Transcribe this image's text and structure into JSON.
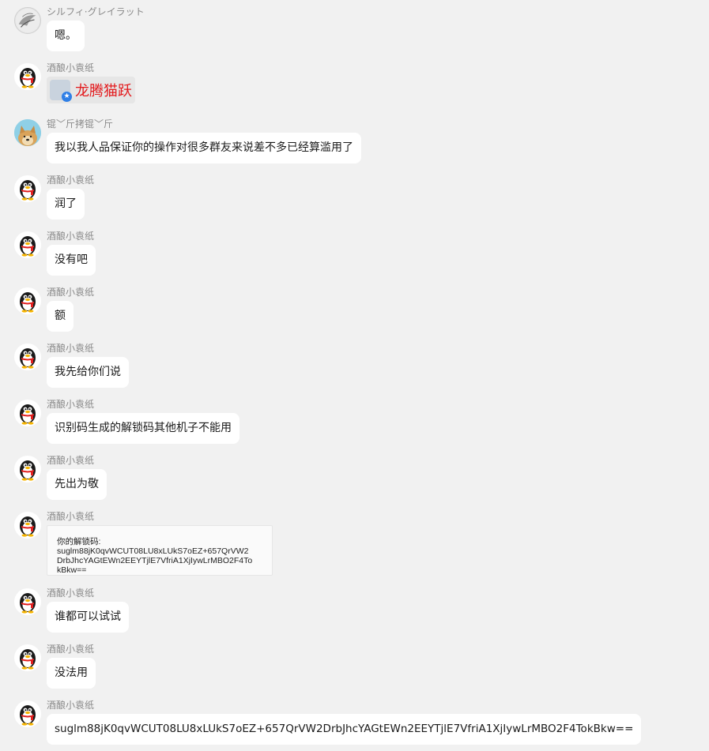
{
  "messages": [
    {
      "sender": "シルフィ·グレイラット",
      "avatar": "sylphy-avatar",
      "type": "text",
      "text": "嗯。"
    },
    {
      "sender": "酒酿小袁纸",
      "avatar": "qq-penguin-avatar",
      "type": "sticker",
      "text": "龙腾猫跃"
    },
    {
      "sender": "锟﹀斤拷锟﹀斤",
      "avatar": "doge-avatar",
      "type": "text",
      "text": "我以我人品保证你的操作对很多群友来说差不多已经算滥用了"
    },
    {
      "sender": "酒酿小袁纸",
      "avatar": "qq-penguin-avatar",
      "type": "text",
      "text": "润了"
    },
    {
      "sender": "酒酿小袁纸",
      "avatar": "qq-penguin-avatar",
      "type": "text",
      "text": "没有吧"
    },
    {
      "sender": "酒酿小袁纸",
      "avatar": "qq-penguin-avatar",
      "type": "text",
      "text": "额"
    },
    {
      "sender": "酒酿小袁纸",
      "avatar": "qq-penguin-avatar",
      "type": "text",
      "text": "我先给你们说"
    },
    {
      "sender": "酒酿小袁纸",
      "avatar": "qq-penguin-avatar",
      "type": "text",
      "text": "识别码生成的解锁码其他机子不能用"
    },
    {
      "sender": "酒酿小袁纸",
      "avatar": "qq-penguin-avatar",
      "type": "text",
      "text": "先出为敬"
    },
    {
      "sender": "酒酿小袁纸",
      "avatar": "qq-penguin-avatar",
      "type": "image",
      "image_lines": [
        "你的解锁码:",
        "suglm88jK0qvWCUT08LU8xLUkS7oEZ+657QrVW2",
        "DrbJhcYAGtEWn2EEYTjlE7VfriA1XjIywLrMBO2F4To",
        "kBkw=="
      ]
    },
    {
      "sender": "酒酿小袁纸",
      "avatar": "qq-penguin-avatar",
      "type": "text",
      "text": "谁都可以试试"
    },
    {
      "sender": "酒酿小袁纸",
      "avatar": "qq-penguin-avatar",
      "type": "text",
      "text": "没法用"
    },
    {
      "sender": "酒酿小袁纸",
      "avatar": "qq-penguin-avatar",
      "type": "text",
      "text": "suglm88jK0qvWCUT08LU8xLUkS7oEZ+657QrVW2DrbJhcYAGtEWn2EEYTjlE7VfriA1XjIywLrMBO2F4TokBkw=="
    }
  ],
  "colors": {
    "background": "#f1f1f1",
    "bubble": "#ffffff",
    "sender_name": "#8a8a8a",
    "sticker_text": "#e3191c"
  }
}
